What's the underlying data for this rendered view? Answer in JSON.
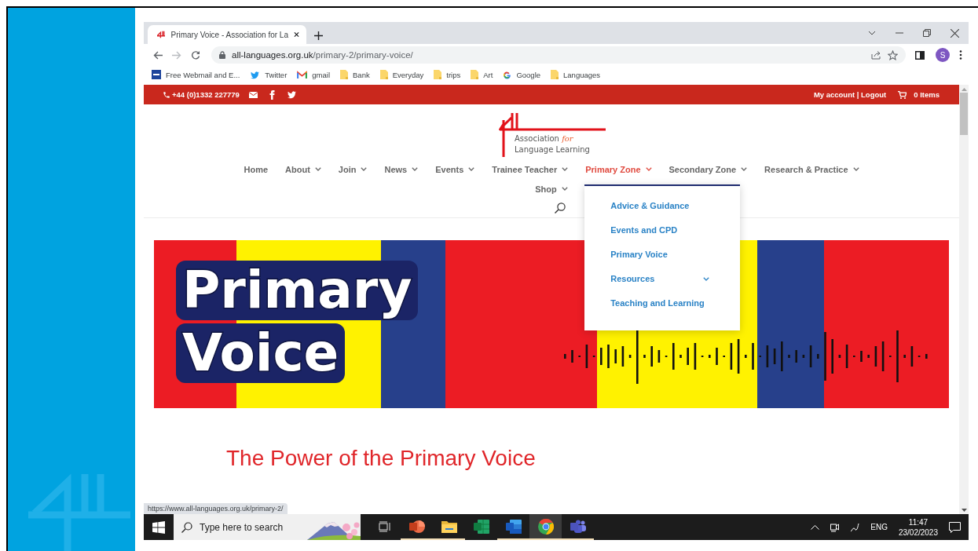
{
  "browser": {
    "tabs": [
      {
        "title": "Primary Voice - Association for La",
        "selected": true
      }
    ],
    "url_host": "all-languages.org.uk",
    "url_path": "/primary-2/primary-voice/",
    "profile_initial": "S",
    "bookmarks": [
      {
        "label": "Free Webmail and E...",
        "kind": "gmx"
      },
      {
        "label": "Twitter",
        "kind": "twitter"
      },
      {
        "label": "gmail",
        "kind": "gmail"
      },
      {
        "label": "Bank",
        "kind": "folder"
      },
      {
        "label": "Everyday",
        "kind": "folder"
      },
      {
        "label": "trips",
        "kind": "folder"
      },
      {
        "label": "Art",
        "kind": "folder"
      },
      {
        "label": "Google",
        "kind": "google"
      },
      {
        "label": "Languages",
        "kind": "folder"
      }
    ],
    "status_url": "https://www.all-languages.org.uk/primary-2/"
  },
  "site": {
    "topbar": {
      "phone": "+44 (0)1332 227779",
      "account": "My account | Logout",
      "cart": "0 Items"
    },
    "logo": {
      "line1": "Association",
      "line1_accent": "for",
      "line2": "Language Learning"
    },
    "nav": [
      {
        "label": "Home",
        "has_menu": false,
        "selected": false
      },
      {
        "label": "About",
        "has_menu": true,
        "selected": false
      },
      {
        "label": "Join",
        "has_menu": true,
        "selected": false
      },
      {
        "label": "News",
        "has_menu": true,
        "selected": false
      },
      {
        "label": "Events",
        "has_menu": true,
        "selected": false
      },
      {
        "label": "Trainee Teacher",
        "has_menu": true,
        "selected": false
      },
      {
        "label": "Primary Zone",
        "has_menu": true,
        "selected": true
      },
      {
        "label": "Secondary Zone",
        "has_menu": true,
        "selected": false
      },
      {
        "label": "Research & Practice",
        "has_menu": true,
        "selected": false
      },
      {
        "label": "Shop",
        "has_menu": true,
        "selected": false
      }
    ],
    "dropdown": [
      {
        "label": "Advice & Guidance",
        "has_submenu": false
      },
      {
        "label": "Events and CPD",
        "has_submenu": false
      },
      {
        "label": "Primary Voice",
        "has_submenu": false
      },
      {
        "label": "Resources",
        "has_submenu": true
      },
      {
        "label": "Teaching and Learning",
        "has_submenu": false
      }
    ],
    "banner": {
      "title_lines": [
        "Primary",
        "Voice"
      ]
    },
    "heading": "The Power of the Primary Voice"
  },
  "taskbar": {
    "search_placeholder": "Type here to search",
    "apps": [
      {
        "kind": "taskview",
        "running": false,
        "selected": false
      },
      {
        "kind": "powerpoint",
        "running": true,
        "selected": false
      },
      {
        "kind": "explorer",
        "running": true,
        "selected": false
      },
      {
        "kind": "excel",
        "running": false,
        "selected": false
      },
      {
        "kind": "word",
        "running": true,
        "selected": false
      },
      {
        "kind": "chrome",
        "running": true,
        "selected": true
      },
      {
        "kind": "teams",
        "running": true,
        "selected": false
      }
    ],
    "language": "ENG",
    "time": "11:47",
    "date": "23/02/2023"
  }
}
